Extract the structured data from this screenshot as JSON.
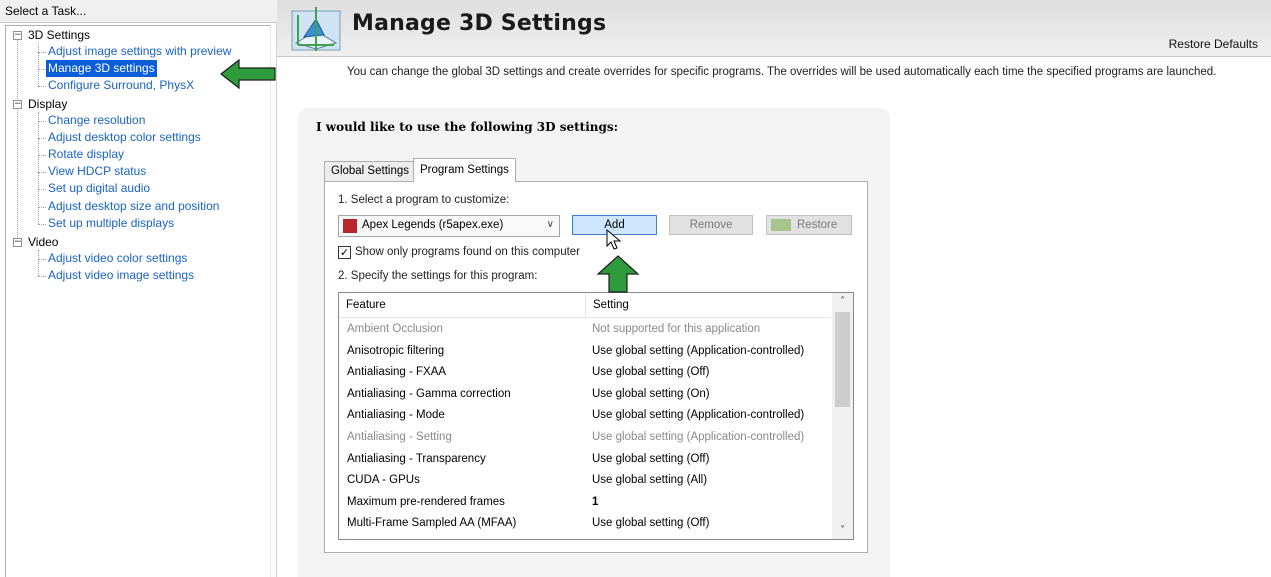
{
  "left_pane": {
    "header": "Select a Task...",
    "categories": [
      {
        "label": "3D Settings",
        "expander": "−",
        "tasks": [
          "Adjust image settings with preview",
          "Manage 3D settings",
          "Configure Surround, PhysX"
        ]
      },
      {
        "label": "Display",
        "expander": "−",
        "tasks": [
          "Change resolution",
          "Adjust desktop color settings",
          "Rotate display",
          "View HDCP status",
          "Set up digital audio",
          "Adjust desktop size and position",
          "Set up multiple displays"
        ]
      },
      {
        "label": "Video",
        "expander": "−",
        "tasks": [
          "Adjust video color settings",
          "Adjust video image settings"
        ]
      }
    ],
    "selected_task": "Manage 3D settings"
  },
  "main": {
    "title": "Manage 3D Settings",
    "restore_defaults": "Restore Defaults",
    "description": "You can change the global 3D settings and create overrides for specific programs. The overrides will be used automatically each time the specified programs are launched.",
    "card_heading": "I would like to use the following 3D settings:",
    "tabs": [
      {
        "label": "Global Settings",
        "active": false
      },
      {
        "label": "Program Settings",
        "active": true
      }
    ],
    "step1_label": "1. Select a program to customize:",
    "program_select": {
      "value": "Apex Legends (r5apex.exe)",
      "chevron": "∨"
    },
    "buttons": {
      "add": "Add",
      "remove": "Remove",
      "restore": "Restore"
    },
    "checkbox": {
      "label": "Show only programs found on this computer",
      "checked": true,
      "mark": "✓"
    },
    "step2_label": "2. Specify the settings for this program:",
    "list": {
      "headers": {
        "feature": "Feature",
        "setting": "Setting"
      },
      "rows": [
        {
          "feature": "Ambient Occlusion",
          "setting": "Not supported for this application",
          "disabled": true
        },
        {
          "feature": "Anisotropic filtering",
          "setting": "Use global setting (Application-controlled)"
        },
        {
          "feature": "Antialiasing - FXAA",
          "setting": "Use global setting (Off)"
        },
        {
          "feature": "Antialiasing - Gamma correction",
          "setting": "Use global setting (On)"
        },
        {
          "feature": "Antialiasing - Mode",
          "setting": "Use global setting (Application-controlled)"
        },
        {
          "feature": "Antialiasing - Setting",
          "setting": "Use global setting (Application-controlled)",
          "disabled": true
        },
        {
          "feature": "Antialiasing - Transparency",
          "setting": "Use global setting (Off)"
        },
        {
          "feature": "CUDA - GPUs",
          "setting": "Use global setting (All)"
        },
        {
          "feature": "Maximum pre-rendered frames",
          "setting": "1",
          "bold": true
        },
        {
          "feature": "Multi-Frame Sampled AA (MFAA)",
          "setting": "Use global setting (Off)"
        }
      ],
      "scroll_up": "˄",
      "scroll_down": "˅"
    }
  },
  "colors": {
    "link": "#1a63c4",
    "selection": "#0a5ed8",
    "annotation_arrow": "#2e9b3c",
    "add_button_bg": "#cfe5fb"
  }
}
